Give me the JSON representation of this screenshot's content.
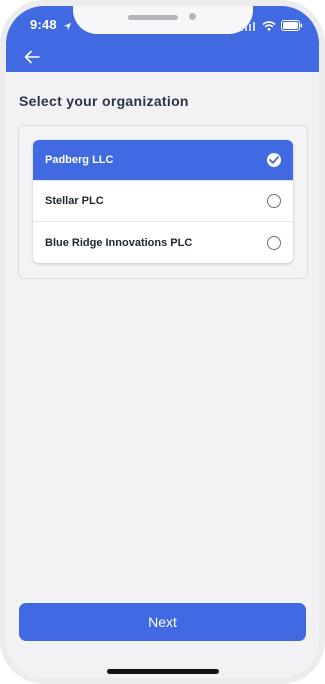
{
  "status_bar": {
    "time": "9:48"
  },
  "header": {
    "back_icon": "arrow-left-icon"
  },
  "page": {
    "title": "Select your organization"
  },
  "organizations": [
    {
      "label": "Padberg LLC",
      "selected": true
    },
    {
      "label": "Stellar PLC",
      "selected": false
    },
    {
      "label": "Blue Ridge Innovations PLC",
      "selected": false
    }
  ],
  "footer": {
    "next_label": "Next"
  },
  "colors": {
    "accent": "#4169e1",
    "background": "#f2f2f5",
    "title_text": "#2b3445"
  }
}
